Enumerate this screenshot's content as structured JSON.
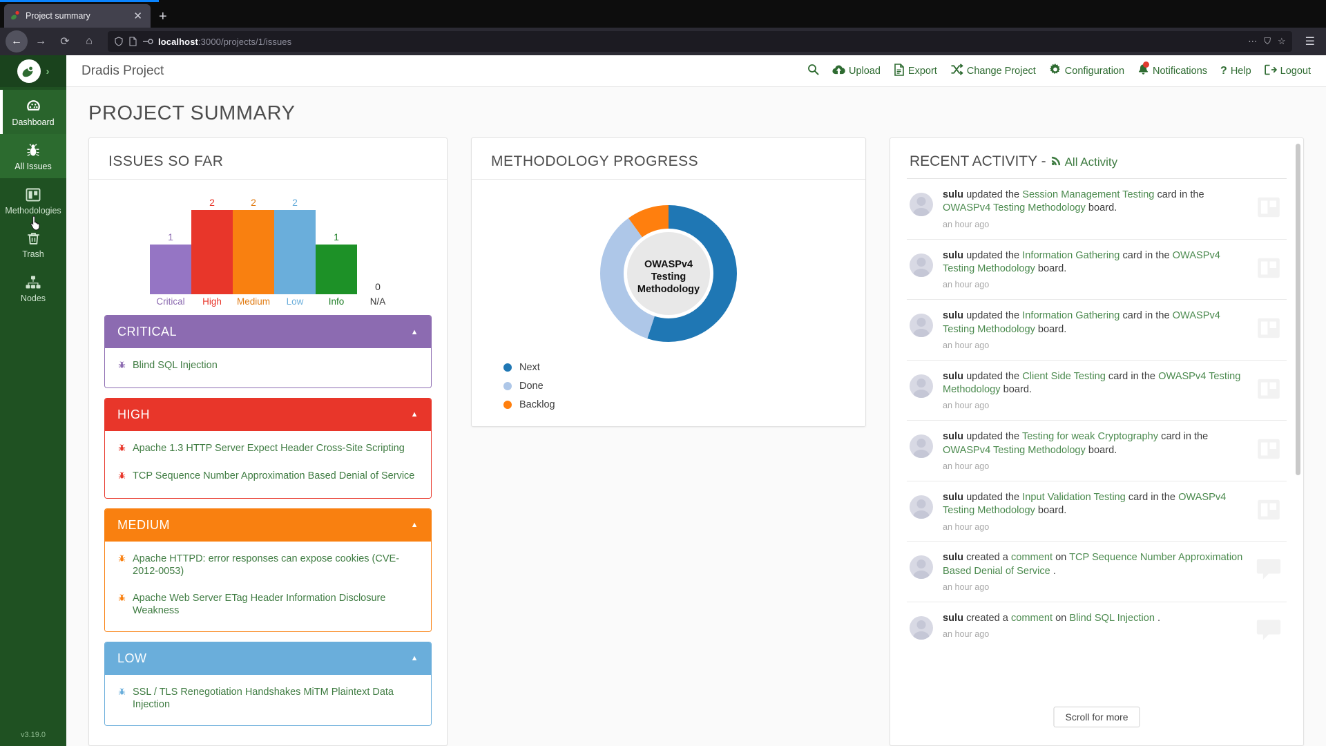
{
  "browser": {
    "tab_title": "Project summary",
    "tab_close": "✕",
    "new_tab": "+",
    "url_full": "localhost:3000/projects/1/issues",
    "url_host": "localhost",
    "url_path": ":3000/projects/1/issues",
    "back": "←",
    "forward": "→",
    "reload": "⟳",
    "home": "⌂",
    "overflow": "⋯",
    "pocket": "⛉",
    "bookmark": "☆",
    "menu": "☰"
  },
  "sidebar": {
    "expand_caret": "›",
    "version": "v3.19.0",
    "items": [
      {
        "label": "Dashboard",
        "icon": "dashboard-icon",
        "state": "active"
      },
      {
        "label": "All Issues",
        "icon": "bug-icon",
        "state": "hover"
      },
      {
        "label": "Methodologies",
        "icon": "methodologies-icon",
        "state": ""
      },
      {
        "label": "Trash",
        "icon": "trash-icon",
        "state": ""
      },
      {
        "label": "Nodes",
        "icon": "nodes-icon",
        "state": ""
      }
    ]
  },
  "header": {
    "brand": "Dradis Project",
    "nav": [
      {
        "label": "",
        "icon": "search-icon"
      },
      {
        "label": "Upload",
        "icon": "upload-cloud-icon"
      },
      {
        "label": "Export",
        "icon": "export-document-icon"
      },
      {
        "label": "Change Project",
        "icon": "shuffle-icon"
      },
      {
        "label": "Configuration",
        "icon": "gear-icon"
      },
      {
        "label": "Notifications",
        "icon": "bell-icon",
        "badge": true
      },
      {
        "label": "Help",
        "icon": "question-mark-icon"
      },
      {
        "label": "Logout",
        "icon": "logout-icon"
      }
    ]
  },
  "page": {
    "title": "PROJECT SUMMARY"
  },
  "issues_panel": {
    "title": "ISSUES SO FAR",
    "groups": [
      {
        "label": "CRITICAL",
        "color": "#8c6bb1",
        "caret": "▲",
        "items": [
          "Blind SQL Injection"
        ]
      },
      {
        "label": "HIGH",
        "color": "#e8362a",
        "caret": "▲",
        "items": [
          "Apache 1.3 HTTP Server Expect Header Cross-Site Scripting",
          "TCP Sequence Number Approximation Based Denial of Service"
        ]
      },
      {
        "label": "MEDIUM",
        "color": "#f98010",
        "caret": "▲",
        "items": [
          "Apache HTTPD: error responses can expose cookies (CVE-2012-0053)",
          "Apache Web Server ETag Header Information Disclosure Weakness"
        ]
      },
      {
        "label": "LOW",
        "color": "#6aaedb",
        "caret": "▲",
        "items": [
          "SSL / TLS Renegotiation Handshakes MiTM Plaintext Data Injection"
        ]
      }
    ]
  },
  "methodology_panel": {
    "title": "METHODOLOGY PROGRESS",
    "center_lines": [
      "OWASPv4",
      "Testing",
      "Methodology"
    ]
  },
  "activity_panel": {
    "title": "RECENT ACTIVITY -",
    "all_activity": "All Activity",
    "rss_icon": "rss-icon",
    "scroll_more": "Scroll for more",
    "items": [
      {
        "user": "sulu",
        "verb": "updated the",
        "link1": "Session Management Testing",
        "mid": "card in the",
        "link2": "OWASPv4 Testing Methodology",
        "tail": "board.",
        "time": "an hour ago",
        "icon": "board-icon"
      },
      {
        "user": "sulu",
        "verb": "updated the",
        "link1": "Information Gathering",
        "mid": "card in the",
        "link2": "OWASPv4 Testing Methodology",
        "tail": "board.",
        "time": "an hour ago",
        "icon": "board-icon"
      },
      {
        "user": "sulu",
        "verb": "updated the",
        "link1": "Information Gathering",
        "mid": "card in the",
        "link2": "OWASPv4 Testing Methodology",
        "tail": "board.",
        "time": "an hour ago",
        "icon": "board-icon"
      },
      {
        "user": "sulu",
        "verb": "updated the",
        "link1": "Client Side Testing",
        "mid": "card in the",
        "link2": "OWASPv4 Testing Methodology",
        "tail": "board.",
        "time": "an hour ago",
        "icon": "board-icon"
      },
      {
        "user": "sulu",
        "verb": "updated the",
        "link1": "Testing for weak Cryptography",
        "mid": "card in the",
        "link2": "OWASPv4 Testing Methodology",
        "tail": "board.",
        "time": "an hour ago",
        "icon": "board-icon"
      },
      {
        "user": "sulu",
        "verb": "updated the",
        "link1": "Input Validation Testing",
        "mid": "card in the",
        "link2": "OWASPv4 Testing Methodology",
        "tail": "board.",
        "time": "an hour ago",
        "icon": "board-icon"
      },
      {
        "user": "sulu",
        "verb": "created a",
        "link1": "comment",
        "mid": "on",
        "link2": "TCP Sequence Number Approximation Based Denial of Service",
        "tail": ".",
        "time": "an hour ago",
        "icon": "comment-icon"
      },
      {
        "user": "sulu",
        "verb": "created a",
        "link1": "comment",
        "mid": "on",
        "link2": "Blind SQL Injection",
        "tail": ".",
        "time": "an hour ago",
        "icon": "comment-icon"
      }
    ]
  },
  "chart_data": [
    {
      "type": "bar",
      "title": "ISSUES SO FAR",
      "categories": [
        "Critical",
        "High",
        "Medium",
        "Low",
        "Info",
        "N/A"
      ],
      "values": [
        1,
        2,
        2,
        2,
        1,
        0
      ],
      "colors": [
        "#9575c4",
        "#e8362a",
        "#f98010",
        "#6aaedb",
        "#1d9127",
        "#333333"
      ],
      "xlabel": "",
      "ylabel": "",
      "ylim": [
        0,
        2
      ],
      "grid": false,
      "legend": "none",
      "data_labels": [
        "1",
        "2",
        "2",
        "2",
        "1",
        "0"
      ]
    },
    {
      "type": "pie",
      "title": "METHODOLOGY PROGRESS",
      "subtitle": "OWASPv4 Testing Methodology",
      "categories": [
        "Next",
        "Done",
        "Backlog"
      ],
      "values": [
        55,
        35,
        10
      ],
      "colors": [
        "#1f77b4",
        "#aec7e8",
        "#ff7f0e"
      ],
      "legend": "bottom-left",
      "donut": true
    }
  ]
}
